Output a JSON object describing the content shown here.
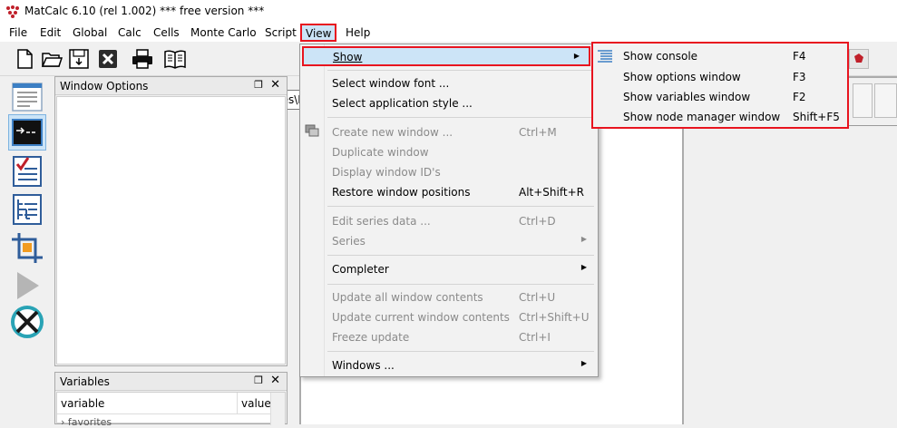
{
  "window": {
    "title": "MatCalc 6.10 (rel 1.002)  *** free version ***"
  },
  "menubar": {
    "items": [
      "File",
      "Edit",
      "Global",
      "Calc",
      "Cells",
      "Monte Carlo",
      "Script",
      "View",
      "Help"
    ]
  },
  "toolbar": {
    "buttons": [
      "new-file-icon",
      "open-folder-icon",
      "save-icon",
      "close-file-icon",
      "print-icon",
      "book-icon",
      "stop-icon"
    ],
    "path_value": "C:\\Program Files\\M"
  },
  "leftbar": {
    "icons": [
      "options-window-icon",
      "console-icon",
      "checklist-icon",
      "tree-icon",
      "crop-icon",
      "play-icon",
      "circle-x-icon"
    ]
  },
  "panels": {
    "window_options": {
      "title": "Window Options"
    },
    "variables": {
      "title": "Variables",
      "columns": [
        "variable",
        "value"
      ],
      "first_row": "favorites"
    }
  },
  "view_menu": {
    "show": "Show",
    "select_window_font": "Select window font ...",
    "select_application_style": "Select application style ...",
    "create_new_window": "Create new window ...",
    "create_new_window_sc": "Ctrl+M",
    "duplicate_window": "Duplicate window",
    "display_window_ids": "Display window ID's",
    "restore_window_positions": "Restore window positions",
    "restore_window_positions_sc": "Alt+Shift+R",
    "edit_series_data": "Edit series data ...",
    "edit_series_data_sc": "Ctrl+D",
    "series": "Series",
    "completer": "Completer",
    "update_all": "Update all window contents",
    "update_all_sc": "Ctrl+U",
    "update_current": "Update current window contents",
    "update_current_sc": "Ctrl+Shift+U",
    "freeze_update": "Freeze update",
    "freeze_update_sc": "Ctrl+I",
    "windows": "Windows ..."
  },
  "show_submenu": {
    "console": "Show console",
    "console_sc": "F4",
    "options": "Show options window",
    "options_sc": "F3",
    "variables": "Show variables window",
    "variables_sc": "F2",
    "node_manager": "Show node manager window",
    "node_manager_sc": "Shift+F5"
  },
  "colors": {
    "highlight_border": "#e8141f",
    "menu_hover": "#cce4f7",
    "disabled_text": "#8a8a8a"
  }
}
